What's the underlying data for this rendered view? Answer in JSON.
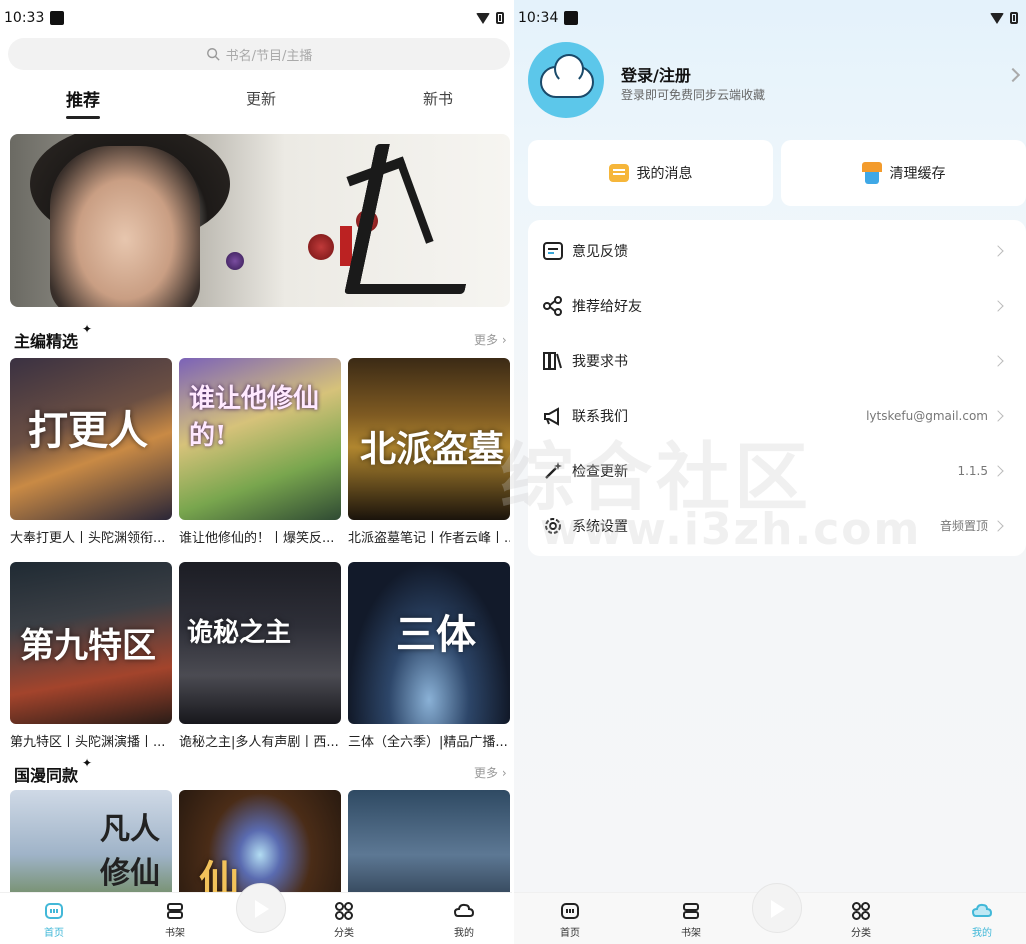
{
  "left": {
    "status": {
      "time": "10:33"
    },
    "search": {
      "placeholder": "书名/节目/主播"
    },
    "tabs": [
      "推荐",
      "更新",
      "新书"
    ],
    "section1": {
      "title": "主编精选",
      "more": "更多"
    },
    "section1_items": [
      {
        "title": "大奉打更人丨头陀渊领衔...",
        "cover_text": "打更人"
      },
      {
        "title": "谁让他修仙的！丨爆笑反...",
        "cover_text": "谁让他修仙的!"
      },
      {
        "title": "北派盗墓笔记丨作者云峰丨...",
        "cover_text": "北派盗墓"
      },
      {
        "title": "第九特区丨头陀渊演播丨...",
        "cover_text": "第九特区"
      },
      {
        "title": "诡秘之主|多人有声剧丨西...",
        "cover_text": "诡秘之主"
      },
      {
        "title": "三体（全六季）|精品广播...",
        "cover_text": "三体"
      }
    ],
    "section2": {
      "title": "国漫同款",
      "more": "更多"
    },
    "section2_covers": [
      {
        "cover_text": "凡人修仙"
      },
      {
        "cover_text": "仙"
      },
      {
        "cover_text": ""
      }
    ],
    "nav": [
      "首页",
      "书架",
      "分类",
      "我的"
    ]
  },
  "right": {
    "status": {
      "time": "10:34"
    },
    "login": {
      "title": "登录/注册",
      "subtitle": "登录即可免费同步云端收藏"
    },
    "actions": {
      "messages": "我的消息",
      "clear_cache": "清理缓存"
    },
    "menu": [
      {
        "label": "意见反馈",
        "value": "",
        "icon": "feedback-icon"
      },
      {
        "label": "推荐给好友",
        "value": "",
        "icon": "share-icon"
      },
      {
        "label": "我要求书",
        "value": "",
        "icon": "books-icon"
      },
      {
        "label": "联系我们",
        "value": "lytskefu@gmail.com",
        "icon": "megaphone-icon"
      },
      {
        "label": "检查更新",
        "value": "1.1.5",
        "icon": "magic-wand-icon"
      },
      {
        "label": "系统设置",
        "value": "音频置顶",
        "icon": "gear-icon"
      }
    ],
    "nav": [
      "首页",
      "书架",
      "分类",
      "我的"
    ],
    "watermark": {
      "line1": "综合社区",
      "line2": "www.i3zh.com"
    }
  },
  "colors": {
    "accent": "#42b8d8",
    "highlight": "#bfe8f4"
  }
}
